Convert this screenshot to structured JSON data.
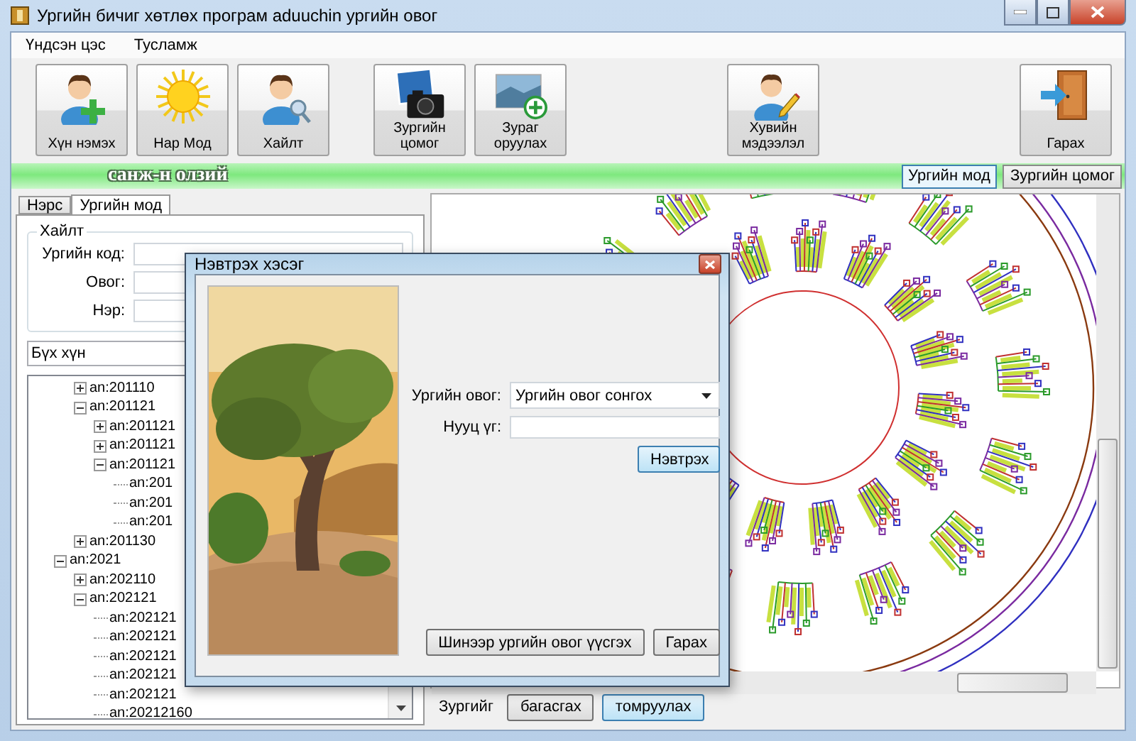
{
  "window": {
    "title": "Ургийн бичиг хөтлөх програм aduuchin ургийн овог"
  },
  "menu": [
    "Үндсэн цэс",
    "Тусламж"
  ],
  "toolbar": [
    [
      {
        "kind": "add-person",
        "label": "Хүн нэмэх"
      },
      {
        "kind": "sun",
        "label": "Нар Мод"
      },
      {
        "kind": "search-person",
        "label": "Хайлт"
      }
    ],
    [
      {
        "kind": "camera",
        "label": "Зургийн цомог"
      },
      {
        "kind": "add-photo",
        "label": "Зураг оруулах"
      }
    ],
    [
      {
        "kind": "edit-person",
        "label": "Хувийн мэдээлэл"
      }
    ],
    [
      {
        "kind": "exit",
        "label": "Гарах"
      }
    ]
  ],
  "banner": {
    "name": "санж-н олзий",
    "tabs": [
      {
        "label": "Ургийн мод",
        "selected": true
      },
      {
        "label": "Зургийн цомог",
        "selected": false
      }
    ]
  },
  "left_panel": {
    "tabs": [
      {
        "label": "Нэрс",
        "selected": false
      },
      {
        "label": "Ургийн мод",
        "selected": true
      }
    ],
    "search": {
      "title": "Хайлт",
      "fields": [
        {
          "label": "Ургийн код:"
        },
        {
          "label": "Овог:"
        },
        {
          "label": "Нэр:"
        }
      ]
    },
    "filter": {
      "value": "Бүх хүн"
    },
    "tree": {
      "partial_branch": [
        {
          "label": "an:201110",
          "expanded": false
        },
        {
          "label": "an:201121",
          "expanded": true,
          "children": [
            {
              "label": "an:201121",
              "expanded": false
            },
            {
              "label": "an:201121",
              "expanded": false
            },
            {
              "label": "an:201121",
              "expanded": true,
              "children": [
                {
                  "label": "an:201"
                },
                {
                  "label": "an:201"
                },
                {
                  "label": "an:201"
                }
              ]
            }
          ]
        },
        {
          "label": "an:201130",
          "expanded": false
        }
      ],
      "items": [
        {
          "label": "an:2021",
          "expanded": true,
          "children": [
            {
              "label": "an:202110",
              "expanded": false
            },
            {
              "label": "an:202121",
              "expanded": true,
              "children": [
                {
                  "label": "an:202121"
                },
                {
                  "label": "an:202121"
                },
                {
                  "label": "an:202121"
                },
                {
                  "label": "an:202121"
                },
                {
                  "label": "an:202121"
                },
                {
                  "label": "an:20212160"
                }
              ]
            }
          ]
        }
      ]
    }
  },
  "zoom_controls": {
    "label": "Зургийг",
    "buttons": [
      {
        "label": "багасгах",
        "focused": false
      },
      {
        "label": "томруулах",
        "focused": true
      }
    ]
  },
  "dialog": {
    "title": "Нэвтрэх хэсэг",
    "clan": {
      "label": "Ургийн овог:",
      "value": "Ургийн овог сонгох"
    },
    "password": {
      "label": "Нууц үг:"
    },
    "login_button": {
      "label": "Нэвтрэх",
      "focused": true
    },
    "footer_buttons": [
      {
        "label": "Шинээр ургийн овог үүсгэх",
        "focused": false
      },
      {
        "label": "Гарах",
        "focused": false
      }
    ]
  }
}
